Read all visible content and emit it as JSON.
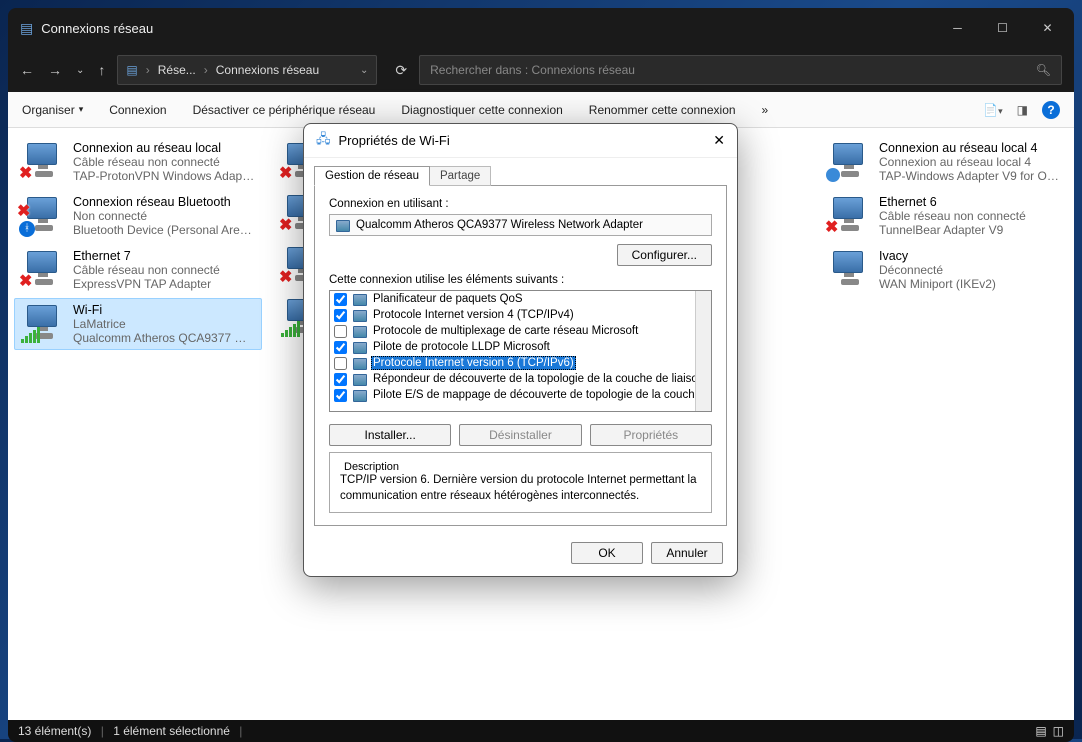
{
  "window": {
    "title": "Connexions réseau",
    "breadcrumb": [
      "Rése...",
      "Connexions réseau"
    ],
    "search_placeholder": "Rechercher dans : Connexions réseau"
  },
  "commandbar": {
    "organize": "Organiser",
    "items": [
      "Connexion",
      "Désactiver ce périphérique réseau",
      "Diagnostiquer cette connexion",
      "Renommer cette connexion"
    ],
    "overflow": "»"
  },
  "adapters_left": [
    {
      "name": "Connexion au réseau local",
      "status": "Câble réseau non connecté",
      "device": "TAP-ProtonVPN Windows Adapter...",
      "badge": "x",
      "selected": false
    },
    {
      "name": "Connexion réseau Bluetooth",
      "status": "Non connecté",
      "device": "Bluetooth Device (Personal Area ...",
      "badge": "bt",
      "selected": false
    },
    {
      "name": "Ethernet 7",
      "status": "Câble réseau non connecté",
      "device": "ExpressVPN TAP Adapter",
      "badge": "x",
      "selected": false
    },
    {
      "name": "Wi-Fi",
      "status": "LaMatrice",
      "device": "Qualcomm Atheros QCA9377 Wir...",
      "badge": "wifi",
      "selected": true
    }
  ],
  "adapters_right": [
    {
      "name": "Connexion au réseau local 4",
      "status": "Connexion au réseau local 4",
      "device": "TAP-Windows Adapter V9 for Ope...",
      "badge": "plug"
    },
    {
      "name": "Ethernet 6",
      "status": "Câble réseau non connecté",
      "device": "TunnelBear Adapter V9",
      "badge": "x"
    },
    {
      "name": "Ivacy",
      "status": "Déconnecté",
      "device": "WAN Miniport (IKEv2)",
      "badge": "none"
    }
  ],
  "statusbar": {
    "count": "13 élément(s)",
    "selected": "1 élément sélectionné"
  },
  "dialog": {
    "title": "Propriétés de Wi-Fi",
    "tabs": [
      "Gestion de réseau",
      "Partage"
    ],
    "connect_label": "Connexion en utilisant :",
    "adapter": "Qualcomm Atheros QCA9377 Wireless Network Adapter",
    "configure": "Configurer...",
    "elements_label": "Cette connexion utilise les éléments suivants :",
    "items": [
      {
        "checked": true,
        "label": "Planificateur de paquets QoS",
        "selected": false
      },
      {
        "checked": true,
        "label": "Protocole Internet version 4 (TCP/IPv4)",
        "selected": false
      },
      {
        "checked": false,
        "label": "Protocole de multiplexage de carte réseau Microsoft",
        "selected": false
      },
      {
        "checked": true,
        "label": "Pilote de protocole LLDP Microsoft",
        "selected": false
      },
      {
        "checked": false,
        "label": "Protocole Internet version 6 (TCP/IPv6)",
        "selected": true
      },
      {
        "checked": true,
        "label": "Répondeur de découverte de la topologie de la couche de liaison",
        "selected": false
      },
      {
        "checked": true,
        "label": "Pilote E/S de mappage de découverte de topologie de la couche de li",
        "selected": false
      }
    ],
    "install": "Installer...",
    "uninstall": "Désinstaller",
    "properties": "Propriétés",
    "description_title": "Description",
    "description_body": "TCP/IP version 6. Dernière version du protocole Internet permettant la communication entre réseaux hétérogènes interconnectés.",
    "ok": "OK",
    "cancel": "Annuler"
  }
}
